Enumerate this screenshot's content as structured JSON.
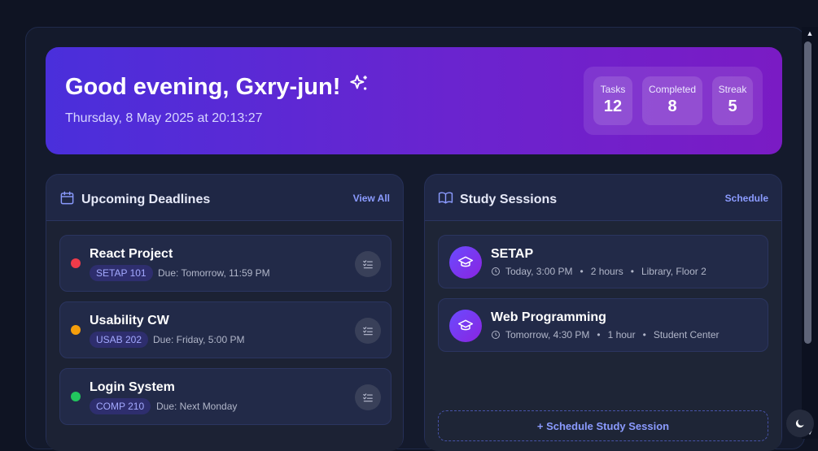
{
  "hero": {
    "greeting": "Good evening, Gxry-jun!",
    "datetime": "Thursday, 8 May 2025 at 20:13:27",
    "stats": [
      {
        "label": "Tasks",
        "value": "12"
      },
      {
        "label": "Completed",
        "value": "8"
      },
      {
        "label": "Streak",
        "value": "5"
      }
    ]
  },
  "deadlines": {
    "title": "Upcoming Deadlines",
    "action": "View All",
    "items": [
      {
        "title": "React Project",
        "tag": "SETAP 101",
        "due": "Due: Tomorrow, 11:59 PM",
        "priority_color": "#ef3b4a"
      },
      {
        "title": "Usability CW",
        "tag": "USAB 202",
        "due": "Due: Friday, 5:00 PM",
        "priority_color": "#f59e0b"
      },
      {
        "title": "Login System",
        "tag": "COMP 210",
        "due": "Due: Next Monday",
        "priority_color": "#22c55e"
      }
    ]
  },
  "sessions": {
    "title": "Study Sessions",
    "action": "Schedule",
    "items": [
      {
        "title": "SETAP",
        "time": "Today, 3:00 PM",
        "duration": "2 hours",
        "location": "Library, Floor 2"
      },
      {
        "title": "Web Programming",
        "time": "Tomorrow, 4:30 PM",
        "duration": "1 hour",
        "location": "Student Center"
      }
    ],
    "schedule_button": "+ Schedule Study Session"
  },
  "colors": {
    "accent": "#8b9bff",
    "hero_start": "#4a2fdb",
    "hero_end": "#7a1bc4"
  }
}
